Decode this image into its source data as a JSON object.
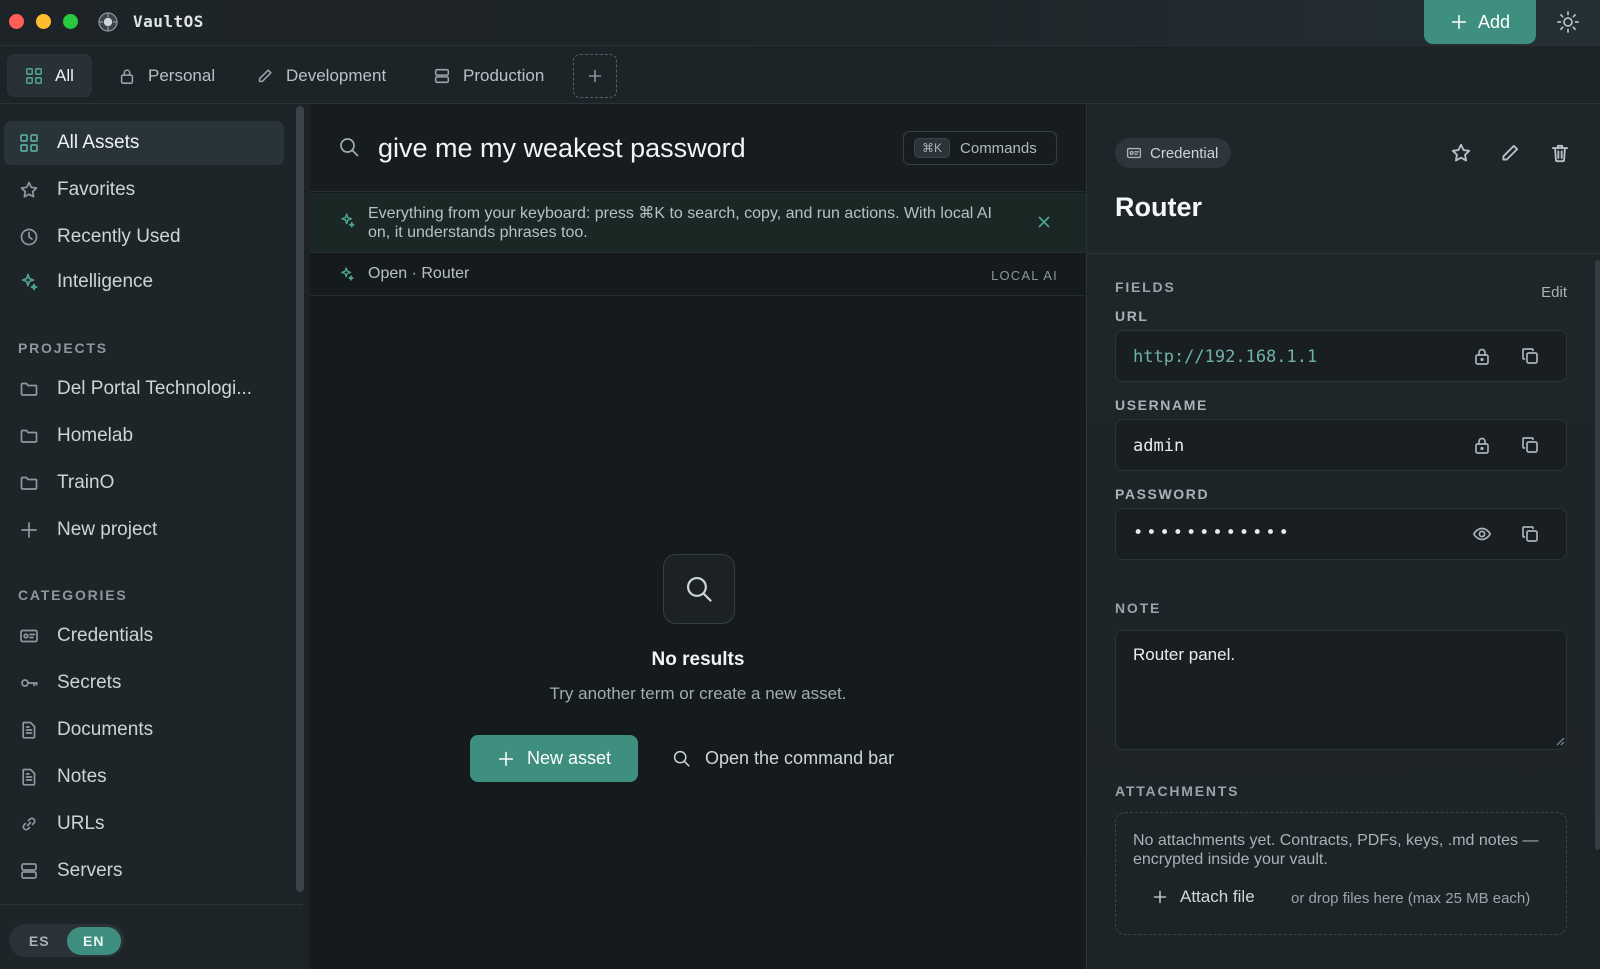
{
  "app": {
    "title": "VaultOS"
  },
  "header": {
    "add_label": "Add"
  },
  "tabs": [
    {
      "label": "All",
      "icon": "grid-icon",
      "active": true
    },
    {
      "label": "Personal",
      "icon": "lock-icon"
    },
    {
      "label": "Development",
      "icon": "pencil-icon"
    },
    {
      "label": "Production",
      "icon": "server-icon"
    }
  ],
  "sidebar": {
    "nav": [
      {
        "label": "All Assets",
        "icon": "grid-icon",
        "active": true
      },
      {
        "label": "Favorites",
        "icon": "star-icon"
      },
      {
        "label": "Recently Used",
        "icon": "clock-icon"
      },
      {
        "label": "Intelligence",
        "icon": "sparkle-icon"
      }
    ],
    "projects_heading": "PROJECTS",
    "projects": [
      {
        "label": "Del Portal Technologi..."
      },
      {
        "label": "Homelab"
      },
      {
        "label": "TrainO"
      }
    ],
    "new_project_label": "New project",
    "categories_heading": "CATEGORIES",
    "categories": [
      {
        "label": "Credentials",
        "icon": "id-card-icon"
      },
      {
        "label": "Secrets",
        "icon": "key-icon"
      },
      {
        "label": "Documents",
        "icon": "document-icon"
      },
      {
        "label": "Notes",
        "icon": "note-icon"
      },
      {
        "label": "URLs",
        "icon": "link-icon"
      },
      {
        "label": "Servers",
        "icon": "server-icon"
      }
    ],
    "languages": [
      "ES",
      "EN"
    ],
    "active_language": "EN"
  },
  "search": {
    "query": "give me my weakest password",
    "shortcut": "⌘K",
    "commands_label": "Commands"
  },
  "hint": {
    "text": "Everything from your keyboard: press ⌘K to search, copy, and run actions. With local AI on, it understands phrases too."
  },
  "suggestion": {
    "text": "Open · Router",
    "tag": "LOCAL AI"
  },
  "empty_state": {
    "title": "No results",
    "subtitle": "Try another term or create a new asset.",
    "new_asset_label": "New asset",
    "open_command_label": "Open the command bar"
  },
  "detail": {
    "type_label": "Credential",
    "title": "Router",
    "fields_heading": "FIELDS",
    "edit_label": "Edit",
    "fields": [
      {
        "label": "URL",
        "value": "http://192.168.1.1"
      },
      {
        "label": "USERNAME",
        "value": "admin"
      },
      {
        "label": "PASSWORD",
        "value": "••••••••••••"
      }
    ],
    "note_heading": "NOTE",
    "note": "Router panel.",
    "attachments_heading": "ATTACHMENTS",
    "attachments_empty": "No attachments yet. Contracts, PDFs, keys, .md notes — encrypted inside your vault.",
    "attach_label": "Attach file",
    "attach_hint": "or drop files here (max 25 MB each)"
  },
  "colors": {
    "accent": "#3f8f80",
    "url_text": "#6fb3a5",
    "background": "#1c2226"
  }
}
